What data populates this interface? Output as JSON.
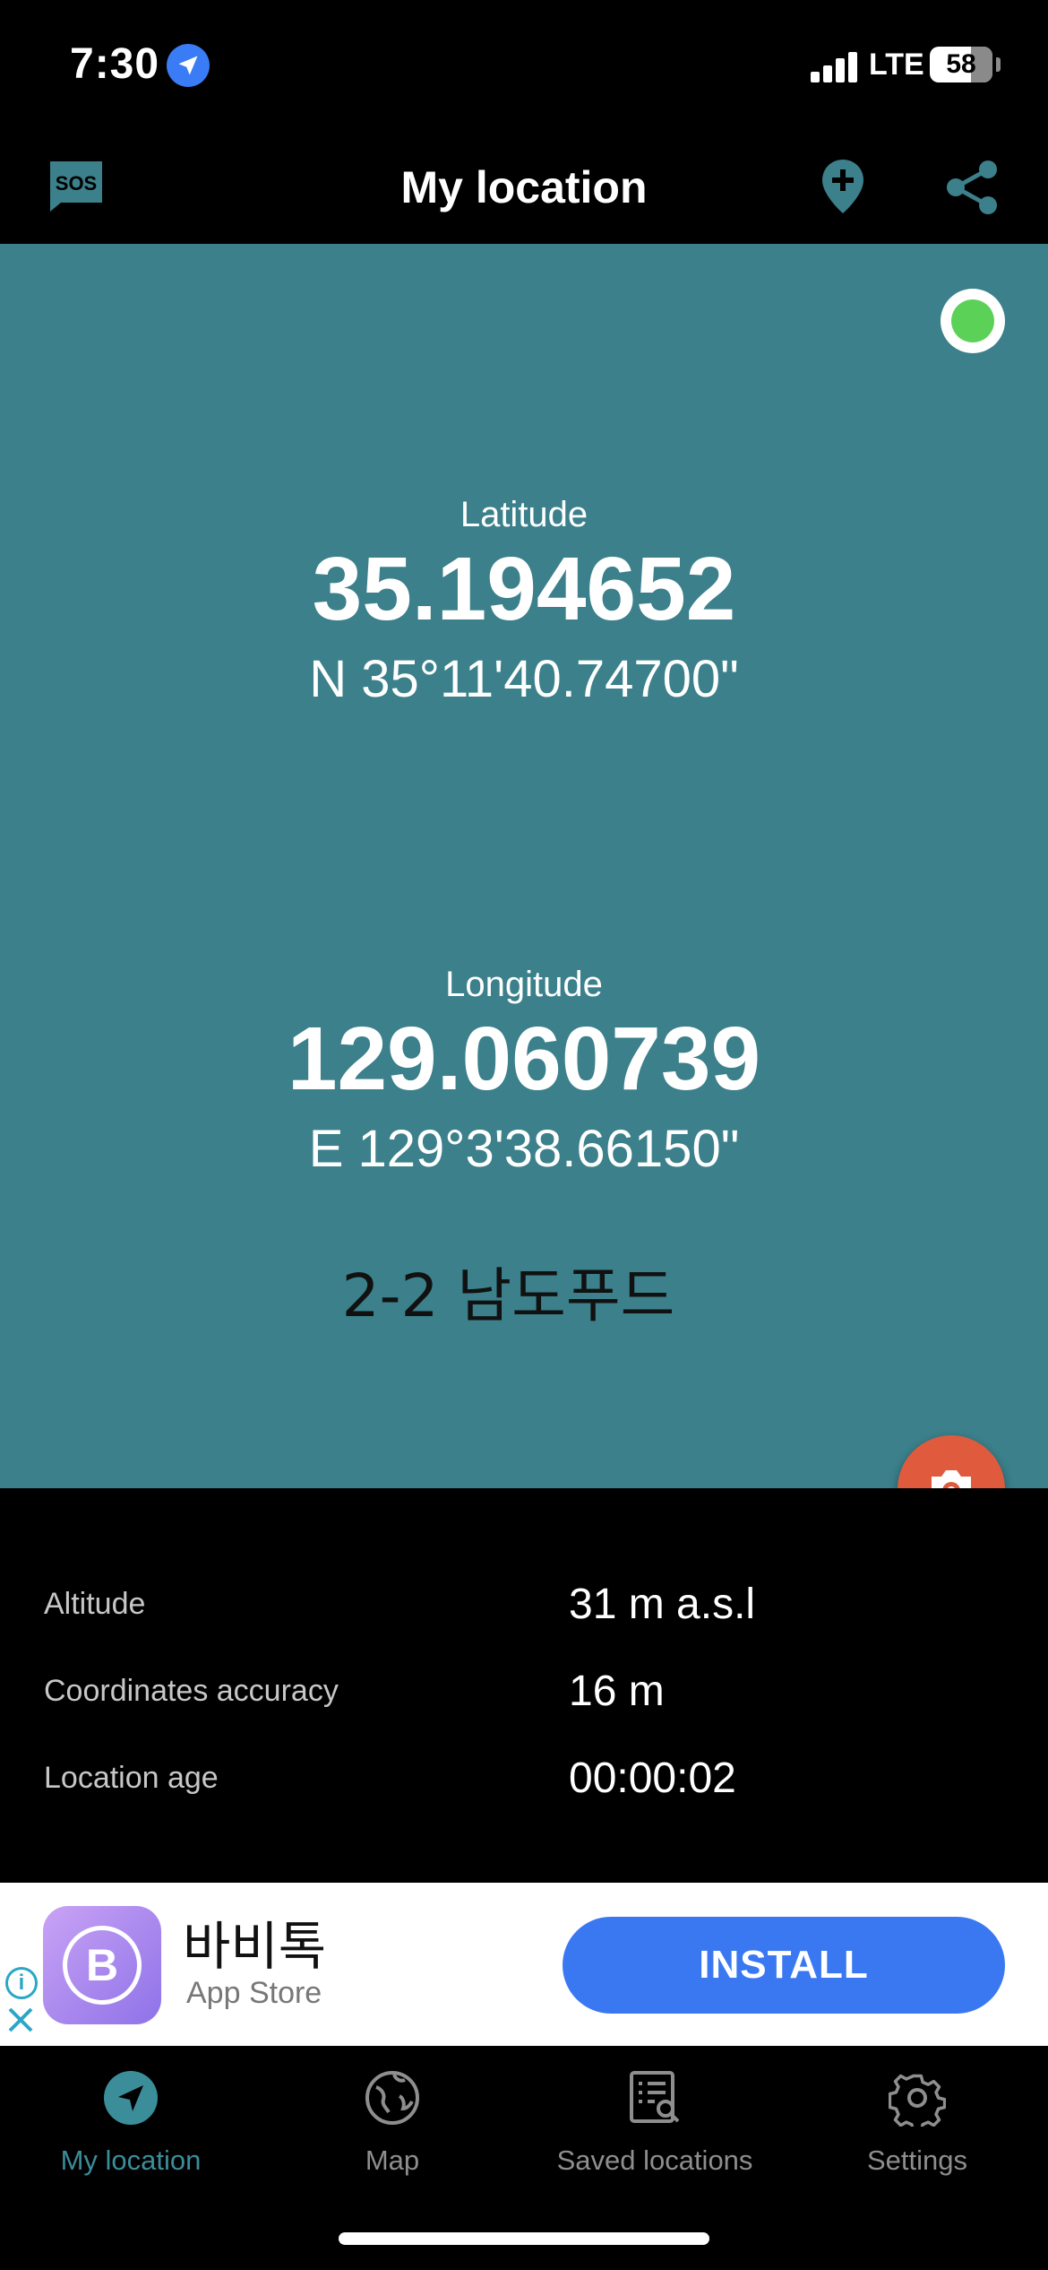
{
  "status_bar": {
    "time": "7:30",
    "network": "LTE",
    "battery": "58",
    "icons": [
      "location-arrow-icon",
      "signal-icon",
      "battery-icon"
    ]
  },
  "header": {
    "title": "My location",
    "sos_label": "SOS",
    "icons": [
      "sos-icon",
      "add-location-pin-icon",
      "share-icon"
    ]
  },
  "coordinates": {
    "latitude_label": "Latitude",
    "latitude_decimal": "35.194652",
    "latitude_dms": "N 35°11'40.74700\"",
    "longitude_label": "Longitude",
    "longitude_decimal": "129.060739",
    "longitude_dms": "E 129°3'38.66150\"",
    "address": "2-2 남도푸드",
    "gps_status_color": "#5cd158"
  },
  "details": [
    {
      "label": "Altitude",
      "value": "31 m a.s.l"
    },
    {
      "label": "Coordinates accuracy",
      "value": "16 m"
    },
    {
      "label": "Location age",
      "value": "00:00:02"
    }
  ],
  "ad": {
    "app_name": "바비톡",
    "store": "App Store",
    "install_label": "INSTALL",
    "icon_letter": "B"
  },
  "nav": [
    {
      "label": "My location",
      "icon": "navigation-arrow-icon",
      "active": true
    },
    {
      "label": "Map",
      "icon": "globe-icon",
      "active": false
    },
    {
      "label": "Saved locations",
      "icon": "saved-list-icon",
      "active": false
    },
    {
      "label": "Settings",
      "icon": "gear-icon",
      "active": false
    }
  ],
  "colors": {
    "teal_panel": "#3b808b",
    "accent": "#3b8d9a",
    "camera_button": "#e05a3e",
    "install_button": "#3a78f2"
  }
}
